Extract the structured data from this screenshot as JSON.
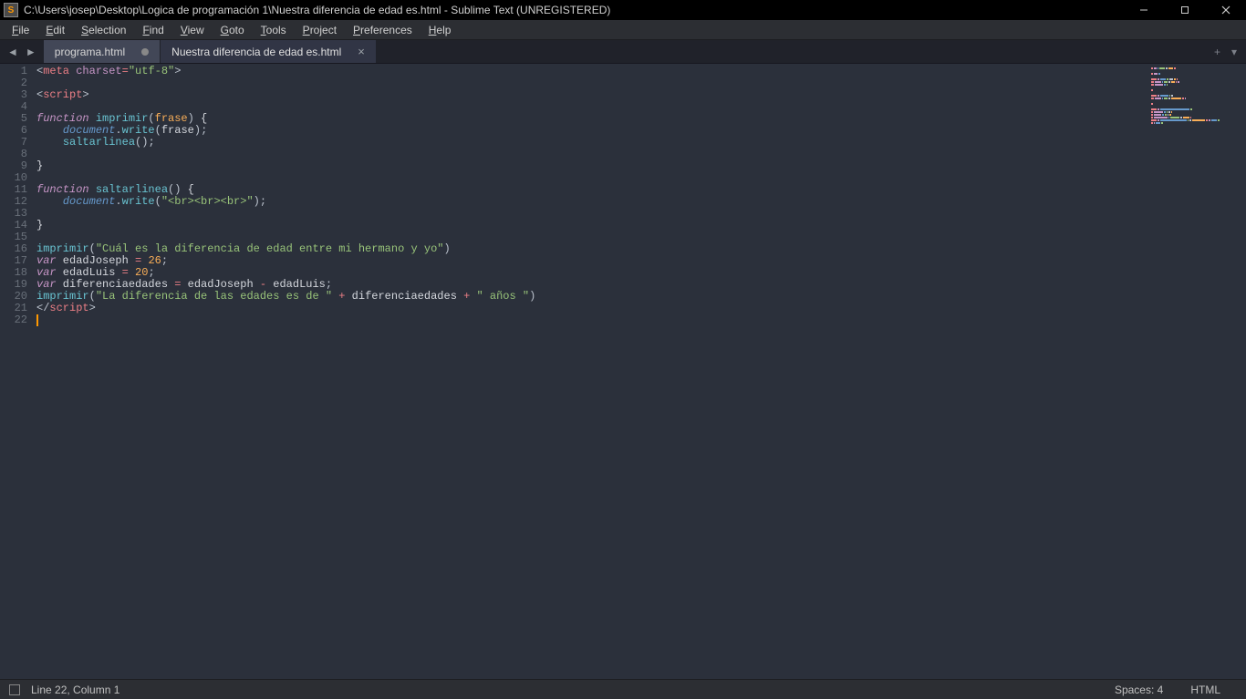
{
  "titlebar": {
    "title": "C:\\Users\\josep\\Desktop\\Logica de programación 1\\Nuestra diferencia de edad es.html - Sublime Text (UNREGISTERED)",
    "app_icon_letter": "S"
  },
  "menubar": {
    "items": [
      {
        "a": "F",
        "rest": "ile"
      },
      {
        "a": "E",
        "rest": "dit"
      },
      {
        "a": "S",
        "rest": "election"
      },
      {
        "a": "F",
        "rest": "ind"
      },
      {
        "a": "V",
        "rest": "iew"
      },
      {
        "a": "G",
        "rest": "oto"
      },
      {
        "a": "T",
        "rest": "ools"
      },
      {
        "a": "P",
        "rest": "roject"
      },
      {
        "a": "P",
        "rest": "references"
      },
      {
        "a": "H",
        "rest": "elp"
      }
    ]
  },
  "tabs": {
    "arrow_left": "◄",
    "arrow_right": "►",
    "items": [
      {
        "label": "programa.html",
        "dirty": true,
        "active": false
      },
      {
        "label": "Nuestra diferencia de edad es.html",
        "dirty": false,
        "active": true
      }
    ],
    "plus": "+",
    "menu": "▾"
  },
  "code": {
    "lines": [
      {
        "n": "1",
        "segs": [
          [
            "<",
            "c-punc"
          ],
          [
            "meta",
            "c-tag"
          ],
          [
            " ",
            "c-white"
          ],
          [
            "charset",
            "c-attr"
          ],
          [
            "=",
            "c-op"
          ],
          [
            "\"utf-8\"",
            "c-str"
          ],
          [
            ">",
            "c-punc"
          ]
        ]
      },
      {
        "n": "2",
        "segs": []
      },
      {
        "n": "3",
        "segs": [
          [
            "<",
            "c-punc"
          ],
          [
            "script",
            "c-tag"
          ],
          [
            ">",
            "c-punc"
          ]
        ]
      },
      {
        "n": "4",
        "segs": []
      },
      {
        "n": "5",
        "segs": [
          [
            "function",
            "c-kw"
          ],
          [
            " ",
            "c-white"
          ],
          [
            "imprimir",
            "c-func"
          ],
          [
            "(",
            "c-punc"
          ],
          [
            "frase",
            "c-param"
          ],
          [
            ")",
            "c-punc"
          ],
          [
            " {",
            "c-white"
          ]
        ]
      },
      {
        "n": "6",
        "segs": [
          [
            "    ",
            "c-white"
          ],
          [
            "document",
            "c-obj"
          ],
          [
            ".",
            "c-punc"
          ],
          [
            "write",
            "c-func"
          ],
          [
            "(",
            "c-punc"
          ],
          [
            "frase",
            "c-white"
          ],
          [
            ")",
            "c-punc"
          ],
          [
            ";",
            "c-punc"
          ]
        ]
      },
      {
        "n": "7",
        "segs": [
          [
            "    ",
            "c-white"
          ],
          [
            "saltarlinea",
            "c-func"
          ],
          [
            "()",
            "c-punc"
          ],
          [
            ";",
            "c-punc"
          ]
        ]
      },
      {
        "n": "8",
        "segs": []
      },
      {
        "n": "9",
        "segs": [
          [
            "}",
            "c-white"
          ]
        ]
      },
      {
        "n": "10",
        "segs": []
      },
      {
        "n": "11",
        "segs": [
          [
            "function",
            "c-kw"
          ],
          [
            " ",
            "c-white"
          ],
          [
            "saltarlinea",
            "c-func"
          ],
          [
            "()",
            "c-punc"
          ],
          [
            " {",
            "c-white"
          ]
        ]
      },
      {
        "n": "12",
        "segs": [
          [
            "    ",
            "c-white"
          ],
          [
            "document",
            "c-obj"
          ],
          [
            ".",
            "c-punc"
          ],
          [
            "write",
            "c-func"
          ],
          [
            "(",
            "c-punc"
          ],
          [
            "\"<br><br><br>\"",
            "c-str"
          ],
          [
            ")",
            "c-punc"
          ],
          [
            ";",
            "c-punc"
          ]
        ]
      },
      {
        "n": "13",
        "segs": []
      },
      {
        "n": "14",
        "segs": [
          [
            "}",
            "c-white"
          ]
        ]
      },
      {
        "n": "15",
        "segs": []
      },
      {
        "n": "16",
        "segs": [
          [
            "imprimir",
            "c-func"
          ],
          [
            "(",
            "c-punc"
          ],
          [
            "\"Cuál es la diferencia de edad entre mi hermano y yo\"",
            "c-str"
          ],
          [
            ")",
            "c-punc"
          ]
        ]
      },
      {
        "n": "17",
        "segs": [
          [
            "var",
            "c-kw"
          ],
          [
            " edadJoseph ",
            "c-white"
          ],
          [
            "=",
            "c-op"
          ],
          [
            " ",
            "c-white"
          ],
          [
            "26",
            "c-num"
          ],
          [
            ";",
            "c-punc"
          ]
        ]
      },
      {
        "n": "18",
        "segs": [
          [
            "var",
            "c-kw"
          ],
          [
            " edadLuis ",
            "c-white"
          ],
          [
            "=",
            "c-op"
          ],
          [
            " ",
            "c-white"
          ],
          [
            "20",
            "c-num"
          ],
          [
            ";",
            "c-punc"
          ]
        ]
      },
      {
        "n": "19",
        "segs": [
          [
            "var",
            "c-kw"
          ],
          [
            " diferenciaedades ",
            "c-white"
          ],
          [
            "=",
            "c-op"
          ],
          [
            " edadJoseph ",
            "c-white"
          ],
          [
            "-",
            "c-op"
          ],
          [
            " edadLuis",
            "c-white"
          ],
          [
            ";",
            "c-punc"
          ]
        ]
      },
      {
        "n": "20",
        "segs": [
          [
            "imprimir",
            "c-func"
          ],
          [
            "(",
            "c-punc"
          ],
          [
            "\"La diferencia de las edades es de \"",
            "c-str"
          ],
          [
            " ",
            "c-white"
          ],
          [
            "+",
            "c-op"
          ],
          [
            " diferenciaedades ",
            "c-white"
          ],
          [
            "+",
            "c-op"
          ],
          [
            " ",
            "c-white"
          ],
          [
            "\" años \"",
            "c-str"
          ],
          [
            ")",
            "c-punc"
          ]
        ]
      },
      {
        "n": "21",
        "segs": [
          [
            "<",
            "c-punc"
          ],
          [
            "/",
            "c-punc"
          ],
          [
            "script",
            "c-tag"
          ],
          [
            ">",
            "c-punc"
          ]
        ]
      },
      {
        "n": "22",
        "cursor": true,
        "segs": []
      }
    ]
  },
  "statusbar": {
    "position": "Line 22, Column 1",
    "spaces": "Spaces: 4",
    "syntax": "HTML"
  }
}
